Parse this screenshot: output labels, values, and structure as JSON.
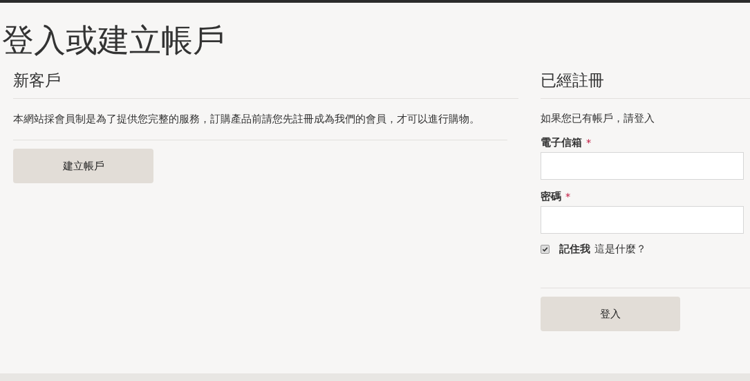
{
  "page_title": "登入或建立帳戶",
  "new_customer": {
    "heading": "新客戶",
    "description": "本網站採會員制是為了提供您完整的服務，訂購產品前請您先註冊成為我們的會員，才可以進行購物。",
    "button": "建立帳戶"
  },
  "registered": {
    "heading": "已經註冊",
    "intro": "如果您已有帳戶，請登入",
    "fields": [
      {
        "label": "電子信箱",
        "required_mark": "*"
      },
      {
        "label": "密碼",
        "required_mark": "*"
      }
    ],
    "remember": {
      "label": "記住我",
      "checked": true,
      "link": "這是什麼？"
    },
    "button": "登入"
  }
}
